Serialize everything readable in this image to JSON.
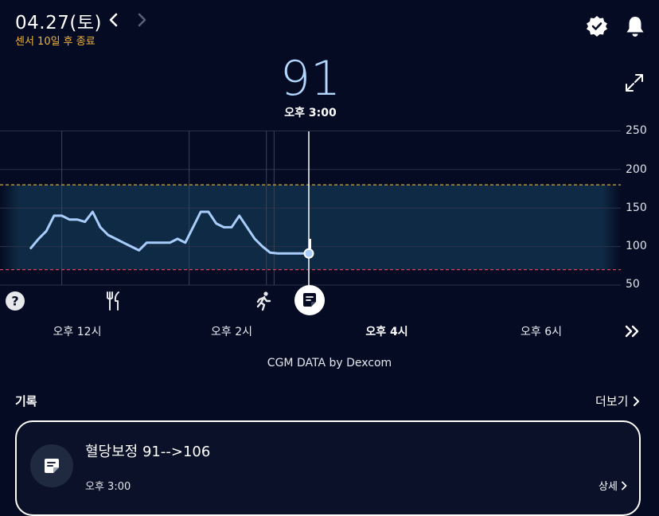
{
  "header": {
    "date": "04.27(토)",
    "sensor_notice": "센서 10일 후 종료",
    "prev_icon": "chevron-left-icon",
    "next_icon": "chevron-right-icon",
    "verified_icon": "verified-badge-icon",
    "bell_icon": "bell-icon"
  },
  "reading": {
    "value": "91",
    "time": "오후 3:00"
  },
  "chart": {
    "y_ticks": [
      "250",
      "200",
      "150",
      "100",
      "50"
    ],
    "x_labels": [
      "오후 12시",
      "오후 2시",
      "오후 4시",
      "오후 6시"
    ],
    "target_range": [
      70,
      180
    ],
    "colors": {
      "line": "#a9cdfb",
      "band": "#0f2a45",
      "high_line": "#d9a830",
      "low_line": "#d9425a"
    }
  },
  "chart_data": {
    "type": "line",
    "ylim": [
      50,
      250
    ],
    "x_hours": [
      11.4,
      11.5,
      11.6,
      11.7,
      11.8,
      11.9,
      12.0,
      12.1,
      12.2,
      12.3,
      12.4,
      12.5,
      12.6,
      12.7,
      12.8,
      12.9,
      13.0,
      13.1,
      13.2,
      13.3,
      13.4,
      13.5,
      13.6,
      13.7,
      13.8,
      13.9,
      14.0,
      14.1,
      14.2,
      14.3,
      14.4,
      14.5,
      14.6,
      14.7,
      14.8,
      14.9,
      15.0
    ],
    "values": [
      98,
      110,
      120,
      140,
      140,
      135,
      135,
      132,
      145,
      125,
      115,
      110,
      105,
      100,
      95,
      105,
      105,
      105,
      105,
      110,
      105,
      125,
      145,
      145,
      130,
      125,
      125,
      140,
      125,
      110,
      100,
      92,
      91,
      91,
      91,
      91,
      91
    ],
    "current": {
      "hour": 15.0,
      "value": 91
    },
    "events": [
      "unknown",
      "meal",
      "exercise",
      "note"
    ]
  },
  "expand_icon": "expand-icon",
  "more_icon": "double-chevron-right-icon",
  "source": "CGM DATA by Dexcom",
  "records": {
    "title": "기록",
    "more_label": "더보기",
    "items": [
      {
        "title": "혈당보정 91-->106",
        "time": "오후 3:00",
        "detail": "상세"
      }
    ]
  }
}
